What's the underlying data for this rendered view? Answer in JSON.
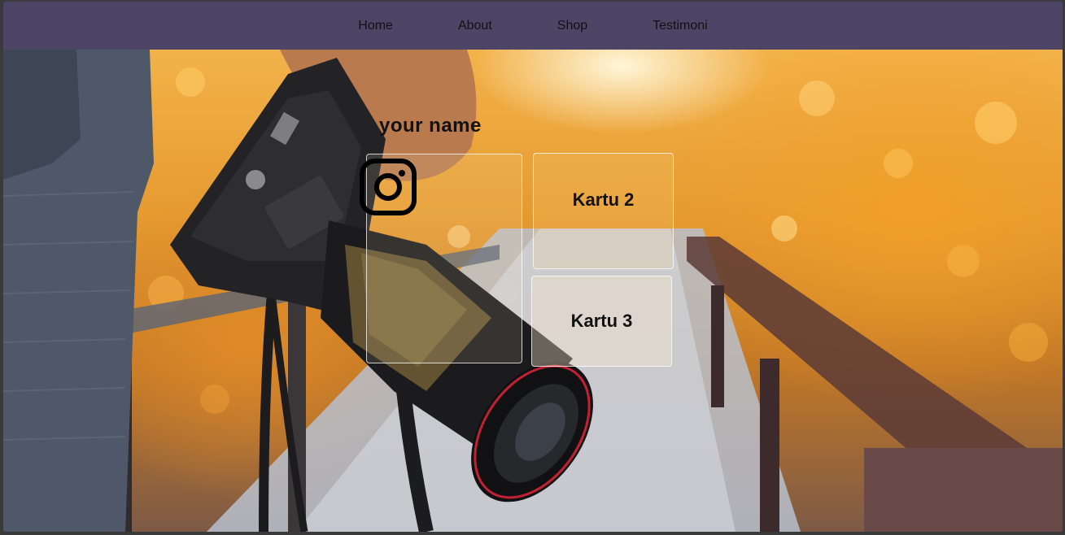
{
  "nav": {
    "items": [
      {
        "label": "Home"
      },
      {
        "label": "About"
      },
      {
        "label": "Shop"
      },
      {
        "label": "Testimoni"
      }
    ]
  },
  "hero": {
    "heading": "your name",
    "cards": [
      {
        "icon": "instagram-icon"
      },
      {
        "label": "Kartu 2"
      },
      {
        "label": "Kartu 3"
      }
    ]
  },
  "colors": {
    "navbar": "#4e4466",
    "text": "#111111",
    "card_border": "#ffffff"
  }
}
